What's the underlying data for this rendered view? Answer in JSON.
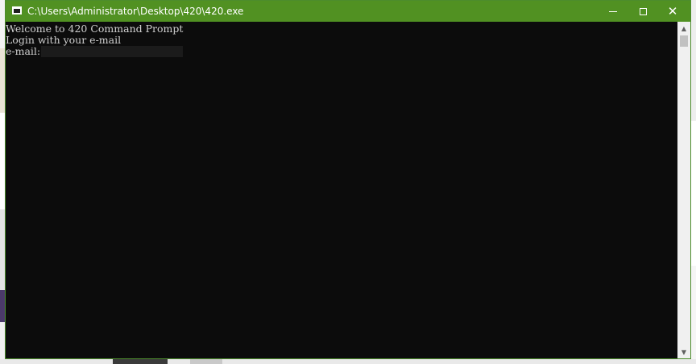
{
  "window": {
    "title": "C:\\Users\\Administrator\\Desktop\\420\\420.exe",
    "app_icon": "console-app-icon",
    "controls": {
      "minimize_icon": "minimize-icon",
      "maximize_icon": "maximize-icon",
      "close_icon": "close-icon",
      "close_glyph": "✕"
    },
    "accent_color": "#519122",
    "background_color": "#0c0c0c",
    "text_color": "#d0d0d0"
  },
  "console": {
    "lines": [
      "Welcome to 420 Command Prompt",
      "Login with your e-mail"
    ],
    "prompt_label": "e-mail:",
    "email_value": ""
  },
  "scrollbar": {
    "up_glyph": "▲",
    "down_glyph": "▼"
  }
}
